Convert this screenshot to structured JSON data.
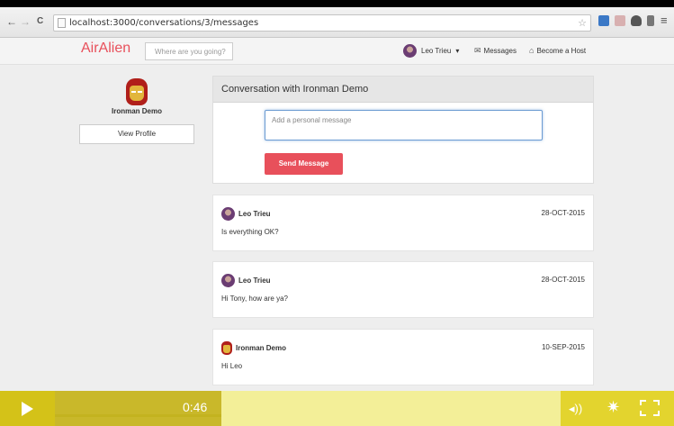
{
  "browser": {
    "url": "localhost:3000/conversations/3/messages",
    "back": "←",
    "forward": "→",
    "reload": "C",
    "star": "☆"
  },
  "header": {
    "logo": "AirAlien",
    "search_placeholder": "Where are you going?",
    "user_name": "Leo Trieu",
    "user_caret": "▾",
    "messages_label": "Messages",
    "host_label": "Become a Host"
  },
  "sidebar": {
    "name": "Ironman Demo",
    "view_profile": "View Profile"
  },
  "conversation": {
    "title": "Conversation with Ironman Demo",
    "input_placeholder": "Add a personal message",
    "send_label": "Send Message"
  },
  "messages": [
    {
      "author": "Leo Trieu",
      "date": "28-OCT-2015",
      "text": "Is everything OK?"
    },
    {
      "author": "Leo Trieu",
      "date": "28-OCT-2015",
      "text": "Hi Tony, how are ya?"
    },
    {
      "author": "Ironman Demo",
      "date": "10-SEP-2015",
      "text": "Hi Leo"
    }
  ],
  "player": {
    "time": "0:46",
    "progress": 0.33,
    "volume_icon": "◂))",
    "settings_icon": "✷"
  },
  "colors": {
    "brand": "#e8505b",
    "player_bar": "#e3d42e"
  }
}
